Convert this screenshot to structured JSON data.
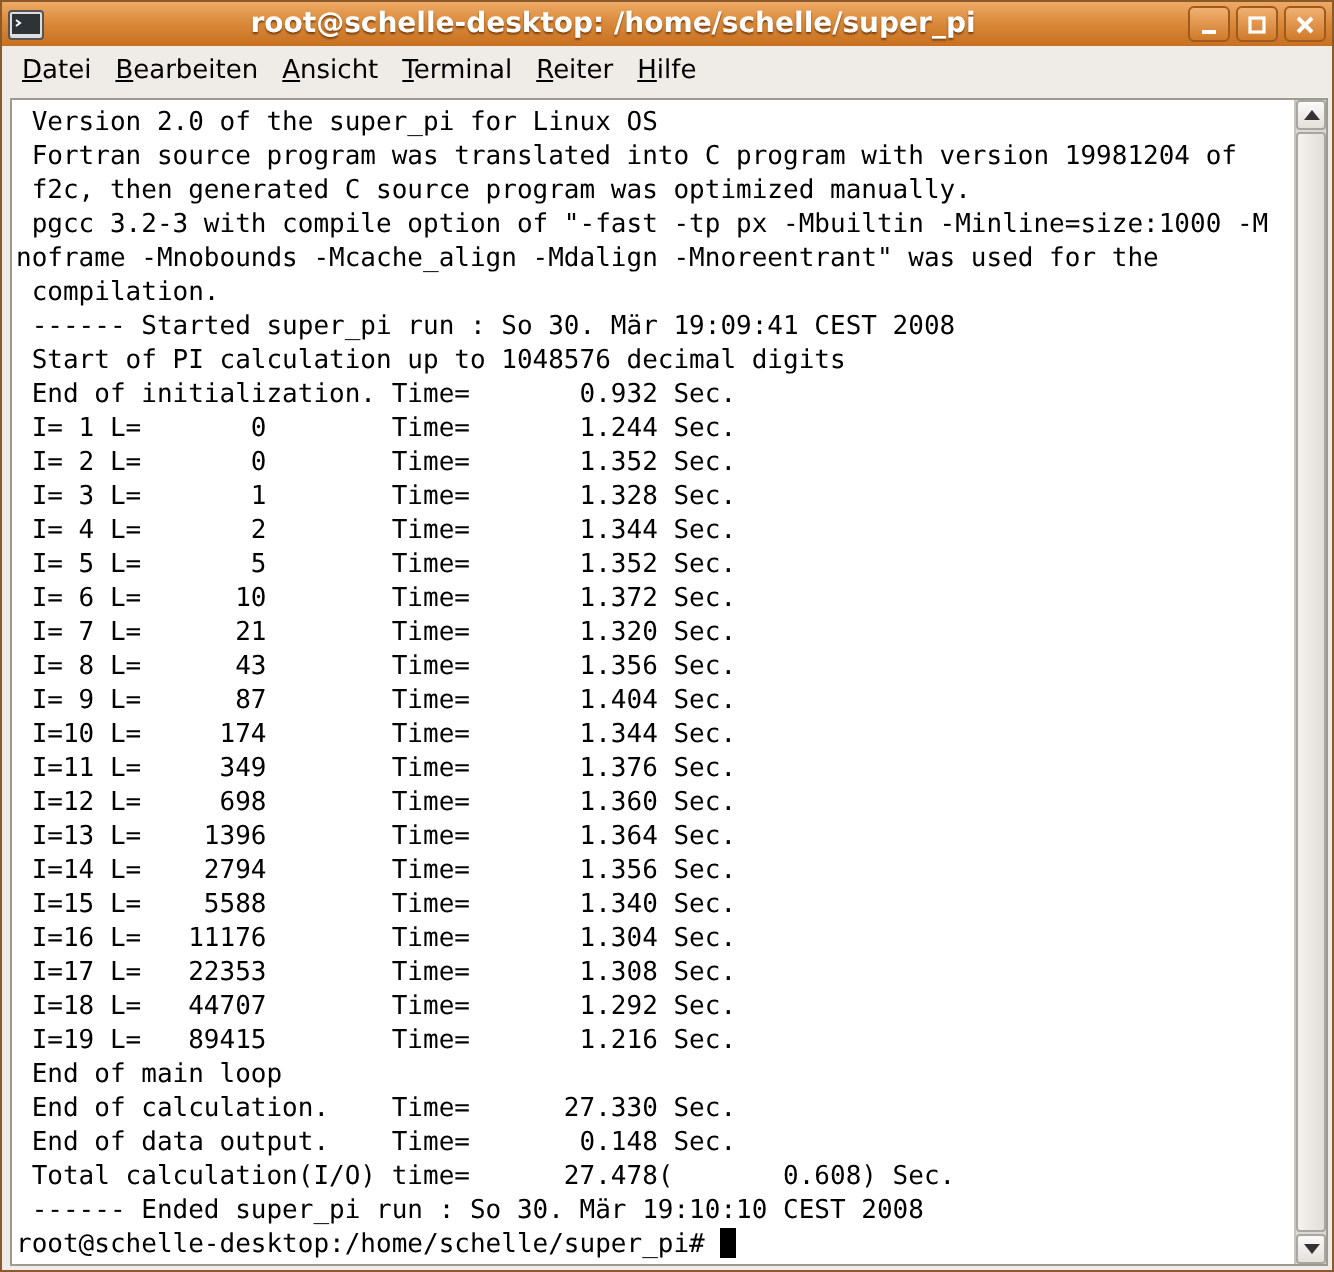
{
  "window": {
    "title": "root@schelle-desktop: /home/schelle/super_pi"
  },
  "menu": [
    {
      "label": "Datei"
    },
    {
      "label": "Bearbeiten"
    },
    {
      "label": "Ansicht"
    },
    {
      "label": "Terminal"
    },
    {
      "label": "Reiter"
    },
    {
      "label": "Hilfe"
    }
  ],
  "terminal": {
    "lines": [
      " Version 2.0 of the super_pi for Linux OS",
      " Fortran source program was translated into C program with version 19981204 of",
      " f2c, then generated C source program was optimized manually.",
      " pgcc 3.2-3 with compile option of \"-fast -tp px -Mbuiltin -Minline=size:1000 -M",
      "noframe -Mnobounds -Mcache_align -Mdalign -Mnoreentrant\" was used for the",
      " compilation.",
      " ------ Started super_pi run : So 30. Mär 19:09:41 CEST 2008",
      " Start of PI calculation up to 1048576 decimal digits",
      " End of initialization. Time=       0.932 Sec.",
      " I= 1 L=       0        Time=       1.244 Sec.",
      " I= 2 L=       0        Time=       1.352 Sec.",
      " I= 3 L=       1        Time=       1.328 Sec.",
      " I= 4 L=       2        Time=       1.344 Sec.",
      " I= 5 L=       5        Time=       1.352 Sec.",
      " I= 6 L=      10        Time=       1.372 Sec.",
      " I= 7 L=      21        Time=       1.320 Sec.",
      " I= 8 L=      43        Time=       1.356 Sec.",
      " I= 9 L=      87        Time=       1.404 Sec.",
      " I=10 L=     174        Time=       1.344 Sec.",
      " I=11 L=     349        Time=       1.376 Sec.",
      " I=12 L=     698        Time=       1.360 Sec.",
      " I=13 L=    1396        Time=       1.364 Sec.",
      " I=14 L=    2794        Time=       1.356 Sec.",
      " I=15 L=    5588        Time=       1.340 Sec.",
      " I=16 L=   11176        Time=       1.304 Sec.",
      " I=17 L=   22353        Time=       1.308 Sec.",
      " I=18 L=   44707        Time=       1.292 Sec.",
      " I=19 L=   89415        Time=       1.216 Sec.",
      " End of main loop",
      " End of calculation.    Time=      27.330 Sec.",
      " End of data output.    Time=       0.148 Sec.",
      " Total calculation(I/O) time=      27.478(       0.608) Sec.",
      " ------ Ended super_pi run : So 30. Mär 19:10:10 CEST 2008"
    ],
    "prompt": "root@schelle-desktop:/home/schelle/super_pi#",
    "cursor": true
  }
}
